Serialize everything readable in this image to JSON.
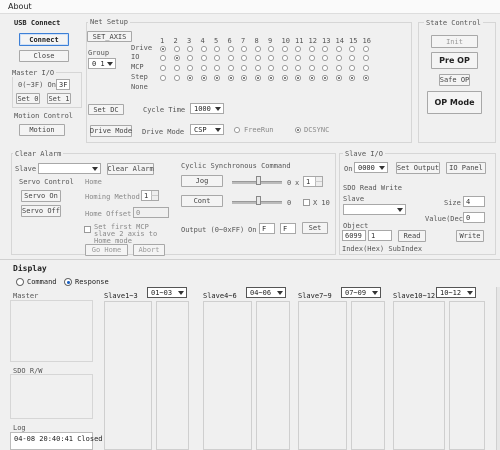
{
  "window": {
    "title": "About"
  },
  "usb": {
    "section": "USB Connect",
    "connect": "Connect",
    "close": "Close"
  },
  "master_io": {
    "section": "Master I/O",
    "range_label": "0(~3F) On",
    "value": "3F",
    "set0": "Set 0",
    "set1": "Set 1"
  },
  "motion_control": {
    "section": "Motion Control",
    "motion": "Motion"
  },
  "net_setup": {
    "section": "Net Setup",
    "set_axis": "SET_AXIS",
    "group_label": "Group",
    "group_value": "0 1",
    "row_labels": [
      "Drive",
      "IO",
      "MCP",
      "Step",
      "None"
    ],
    "columns": [
      "1",
      "2",
      "3",
      "4",
      "5",
      "6",
      "7",
      "8",
      "9",
      "10",
      "11",
      "12",
      "13",
      "14",
      "15",
      "16"
    ],
    "set_dc": "Set DC",
    "cycle_time_label": "Cycle Time",
    "cycle_time_value": "1000",
    "drive_mode_btn": "Drive Mode",
    "drive_mode_label": "Drive Mode",
    "drive_mode_value": "CSP",
    "freerun": "FreeRun",
    "dcsync": "DCSYNC"
  },
  "state_control": {
    "section": "State Control",
    "init": "Init",
    "preop": "Pre OP",
    "safeop": "Safe OP",
    "op": "OP Mode"
  },
  "clear_alarm": {
    "section": "Clear Alarm",
    "slave_label": "Slave",
    "clear_btn": "Clear Alarm"
  },
  "servo_control": {
    "section": "Servo Control",
    "servo_on": "Servo On",
    "servo_off": "Servo Off"
  },
  "home": {
    "section": "Home",
    "homing_method": "Homing Method",
    "method_value": "1",
    "home_offset": "Home Offset",
    "offset_value": "0",
    "chk_label": "Set first MCP slave 2 axis to Home mode",
    "go_home": "Go Home",
    "abort": "Abort"
  },
  "cyclic": {
    "section": "Cyclic Synchronous Command",
    "jog": "Jog",
    "cont": "Cont",
    "jog_val": "0",
    "jog_spin": "1",
    "cont_val": "0",
    "x10": "X 10",
    "output_label": "Output (0~0xFF)",
    "on_label": "On",
    "out1": "F",
    "out2": "F",
    "set": "Set"
  },
  "slave_io": {
    "section": "Slave I/O",
    "on_label": "On",
    "value": "0000",
    "set_output": "Set Output",
    "io_panel": "IO Panel"
  },
  "sdo": {
    "section": "SDO Read Write",
    "slave_label": "Slave",
    "size_label": "Size",
    "size_value": "4",
    "value_label": "Value(Dec)",
    "value_value": "0",
    "object_label": "Object",
    "index_value": "6099",
    "subindex_value": "1",
    "read": "Read",
    "write": "Write",
    "index_hint": "Index(Hex) SubIndex"
  },
  "display": {
    "section": "Display",
    "command": "Command",
    "response": "Response",
    "master": "Master",
    "sdo_rw": "SDO R/W",
    "log": "Log",
    "log_line": "04-08 20:40:41  Closed",
    "groups": [
      {
        "label": "Slave1~3",
        "select": "01~03"
      },
      {
        "label": "Slave4~6",
        "select": "04~06"
      },
      {
        "label": "Slave7~9",
        "select": "07~09"
      },
      {
        "label": "Slave10~12",
        "select": "10~12"
      }
    ]
  }
}
